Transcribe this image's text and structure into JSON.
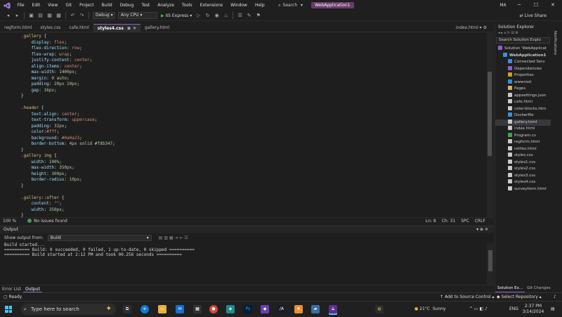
{
  "titlebar": {
    "menu": [
      "File",
      "Edit",
      "View",
      "Git",
      "Project",
      "Build",
      "Debug",
      "Test",
      "Analyze",
      "Tools",
      "Extensions",
      "Window",
      "Help"
    ],
    "search_label": "Search",
    "project_name": "WebApplication1",
    "avatar_initials": "MA"
  },
  "toolbar": {
    "config": "Debug",
    "platform": "Any CPU",
    "run_target": "IIS Express",
    "live_share": "Live Share"
  },
  "tabs": {
    "items": [
      "regform.html",
      "styles.css",
      "cafe.html",
      "styles4.css",
      "gallery.html"
    ],
    "right": "index.html"
  },
  "editor": {
    "lines": [
      [
        {
          "t": ".gallery",
          "c": "sel"
        },
        {
          "t": " {",
          "c": "pun"
        }
      ],
      [
        {
          "t": "    display",
          "c": "prop"
        },
        {
          "t": ": ",
          "c": "pun"
        },
        {
          "t": "flex",
          "c": "val"
        },
        {
          "t": ";",
          "c": "pun"
        }
      ],
      [
        {
          "t": "    flex-direction",
          "c": "prop"
        },
        {
          "t": ": ",
          "c": "pun"
        },
        {
          "t": "row",
          "c": "val"
        },
        {
          "t": ";",
          "c": "pun"
        }
      ],
      [
        {
          "t": "    flex-wrap",
          "c": "prop"
        },
        {
          "t": ": ",
          "c": "pun"
        },
        {
          "t": "wrap",
          "c": "val"
        },
        {
          "t": ";",
          "c": "pun"
        }
      ],
      [
        {
          "t": "    justify-content",
          "c": "prop"
        },
        {
          "t": ": ",
          "c": "pun"
        },
        {
          "t": "center",
          "c": "val"
        },
        {
          "t": ";",
          "c": "pun"
        }
      ],
      [
        {
          "t": "    align-items",
          "c": "prop"
        },
        {
          "t": ": ",
          "c": "pun"
        },
        {
          "t": "center",
          "c": "val"
        },
        {
          "t": ";",
          "c": "pun"
        }
      ],
      [
        {
          "t": "    max-width",
          "c": "prop"
        },
        {
          "t": ": ",
          "c": "pun"
        },
        {
          "t": "1400px",
          "c": "num"
        },
        {
          "t": ";",
          "c": "pun"
        }
      ],
      [
        {
          "t": "    margin",
          "c": "prop"
        },
        {
          "t": ": ",
          "c": "pun"
        },
        {
          "t": "0 auto",
          "c": "num"
        },
        {
          "t": ";",
          "c": "pun"
        }
      ],
      [
        {
          "t": "    padding",
          "c": "prop"
        },
        {
          "t": ": ",
          "c": "pun"
        },
        {
          "t": "20px 10px",
          "c": "num"
        },
        {
          "t": ";",
          "c": "pun"
        }
      ],
      [
        {
          "t": "    gap",
          "c": "prop"
        },
        {
          "t": ": ",
          "c": "pun"
        },
        {
          "t": "16px",
          "c": "num"
        },
        {
          "t": ";",
          "c": "pun"
        }
      ],
      [
        {
          "t": "}",
          "c": "pun"
        }
      ],
      [
        {
          "t": "",
          "c": "pun"
        }
      ],
      [
        {
          "t": ".header",
          "c": "sel"
        },
        {
          "t": " {",
          "c": "pun"
        }
      ],
      [
        {
          "t": "    text-align",
          "c": "prop"
        },
        {
          "t": ": ",
          "c": "pun"
        },
        {
          "t": "center",
          "c": "val"
        },
        {
          "t": ";",
          "c": "pun"
        }
      ],
      [
        {
          "t": "    text-transform",
          "c": "prop"
        },
        {
          "t": ": ",
          "c": "pun"
        },
        {
          "t": "uppercase",
          "c": "val"
        },
        {
          "t": ";",
          "c": "pun"
        }
      ],
      [
        {
          "t": "    padding",
          "c": "prop"
        },
        {
          "t": ": ",
          "c": "pun"
        },
        {
          "t": "32px",
          "c": "num"
        },
        {
          "t": ";",
          "c": "pun"
        }
      ],
      [
        {
          "t": "    color",
          "c": "prop"
        },
        {
          "t": ":",
          "c": "pun"
        },
        {
          "t": "#fff",
          "c": "val"
        },
        {
          "t": ";",
          "c": "pun"
        }
      ],
      [
        {
          "t": "    background",
          "c": "prop"
        },
        {
          "t": ": ",
          "c": "pun"
        },
        {
          "t": "#0a0a23",
          "c": "val"
        },
        {
          "t": ";",
          "c": "pun"
        }
      ],
      [
        {
          "t": "    border-bottom",
          "c": "prop"
        },
        {
          "t": ": ",
          "c": "pun"
        },
        {
          "t": "4px solid #fdb347",
          "c": "num"
        },
        {
          "t": ";",
          "c": "pun"
        }
      ],
      [
        {
          "t": "}",
          "c": "pun"
        }
      ],
      [
        {
          "t": ".gallery img",
          "c": "sel"
        },
        {
          "t": " {",
          "c": "pun"
        }
      ],
      [
        {
          "t": "    width",
          "c": "prop"
        },
        {
          "t": ": ",
          "c": "pun"
        },
        {
          "t": "100%",
          "c": "num"
        },
        {
          "t": ";",
          "c": "pun"
        }
      ],
      [
        {
          "t": "    max-width",
          "c": "prop"
        },
        {
          "t": ": ",
          "c": "pun"
        },
        {
          "t": "350px",
          "c": "num"
        },
        {
          "t": ";",
          "c": "pun"
        }
      ],
      [
        {
          "t": "    height",
          "c": "prop"
        },
        {
          "t": ": ",
          "c": "pun"
        },
        {
          "t": "300px",
          "c": "num"
        },
        {
          "t": ";",
          "c": "pun"
        }
      ],
      [
        {
          "t": "    border-radius",
          "c": "prop"
        },
        {
          "t": ": ",
          "c": "pun"
        },
        {
          "t": "10px",
          "c": "num"
        },
        {
          "t": ";",
          "c": "pun"
        }
      ],
      [
        {
          "t": "}",
          "c": "pun"
        }
      ],
      [
        {
          "t": "",
          "c": "pun"
        }
      ],
      [
        {
          "t": ".gallery::after",
          "c": "sel"
        },
        {
          "t": " {",
          "c": "pun"
        }
      ],
      [
        {
          "t": "    content",
          "c": "prop"
        },
        {
          "t": ": ",
          "c": "pun"
        },
        {
          "t": "\"\"",
          "c": "val"
        },
        {
          "t": ";",
          "c": "pun"
        }
      ],
      [
        {
          "t": "    width",
          "c": "prop"
        },
        {
          "t": ": ",
          "c": "pun"
        },
        {
          "t": "350px",
          "c": "num"
        },
        {
          "t": ";",
          "c": "pun"
        }
      ],
      [
        {
          "t": "}",
          "c": "pun"
        }
      ]
    ]
  },
  "editor_status": {
    "zoom": "100 %",
    "issues": "No issues found",
    "line": "Ln: 8",
    "col": "Ch: 31",
    "spc": "SPC",
    "eol": "CRLF"
  },
  "output": {
    "title": "Output",
    "from_label": "Show output from:",
    "from_value": "Build",
    "text": "Build started...\n========== Build: 0 succeeded, 0 failed, 1 up-to-date, 0 skipped ==========\n========== Build started at 2:12 PM and took 00.256 seconds =========="
  },
  "bottom_tabs": [
    "Error List",
    "Output"
  ],
  "solution": {
    "title": "Solution Explorer",
    "search_placeholder": "Search Solution Explo",
    "items": [
      {
        "label": "Solution 'WebApplicat",
        "indent": 0,
        "color": "#8e5fd4"
      },
      {
        "label": "WebApplication1",
        "indent": 1,
        "color": "#3b8ede",
        "bold": true
      },
      {
        "label": "Connected Serv",
        "indent": 2,
        "color": "#3b8ede"
      },
      {
        "label": "Dependencies",
        "indent": 2,
        "color": "#8e5fd4"
      },
      {
        "label": "Properties",
        "indent": 2,
        "color": "#c9a227"
      },
      {
        "label": "wwwroot",
        "indent": 2,
        "color": "#3b8ede"
      },
      {
        "label": "Pages",
        "indent": 2,
        "color": "#dcb256"
      },
      {
        "label": "appsettings.json",
        "indent": 2,
        "color": "#c9c9c9"
      },
      {
        "label": "cafe.html",
        "indent": 2,
        "color": "#c9c9c9"
      },
      {
        "label": "color-blocks.htm",
        "indent": 2,
        "color": "#c9c9c9"
      },
      {
        "label": "Dockerfile",
        "indent": 2,
        "color": "#3b8ede"
      },
      {
        "label": "gallery.html",
        "indent": 2,
        "color": "#c9c9c9",
        "selected": true
      },
      {
        "label": "index.html",
        "indent": 2,
        "color": "#c9c9c9"
      },
      {
        "label": "Program.cs",
        "indent": 2,
        "color": "#3fa34d"
      },
      {
        "label": "regform.html",
        "indent": 2,
        "color": "#c9c9c9"
      },
      {
        "label": "rothko.html",
        "indent": 2,
        "color": "#c9c9c9"
      },
      {
        "label": "styles.css",
        "indent": 2,
        "color": "#c9c9c9"
      },
      {
        "label": "styles1.css",
        "indent": 2,
        "color": "#c9c9c9"
      },
      {
        "label": "styles2.css",
        "indent": 2,
        "color": "#c9c9c9"
      },
      {
        "label": "styles3.css",
        "indent": 2,
        "color": "#c9c9c9"
      },
      {
        "label": "styles4.css",
        "indent": 2,
        "color": "#c9c9c9"
      },
      {
        "label": "surveyform.html",
        "indent": 2,
        "color": "#c9c9c9"
      }
    ],
    "bottom_tabs": [
      "Solution Ex...",
      "Git Changes"
    ]
  },
  "notifications_label": "Notifications",
  "statusbar": {
    "ready": "Ready",
    "source_control": "Add to Source Control",
    "repository": "Select Repository"
  },
  "taskbar": {
    "search_placeholder": "Type here to search",
    "weather_temp": "21°C",
    "weather_desc": "Sunny",
    "lang": "ENG",
    "time": "2:37 PM",
    "date": "3/14/2024"
  },
  "colors": {
    "accent": "#8e5fd4",
    "project_badge": "#6b3a6e",
    "ok": "#3ea04a"
  }
}
